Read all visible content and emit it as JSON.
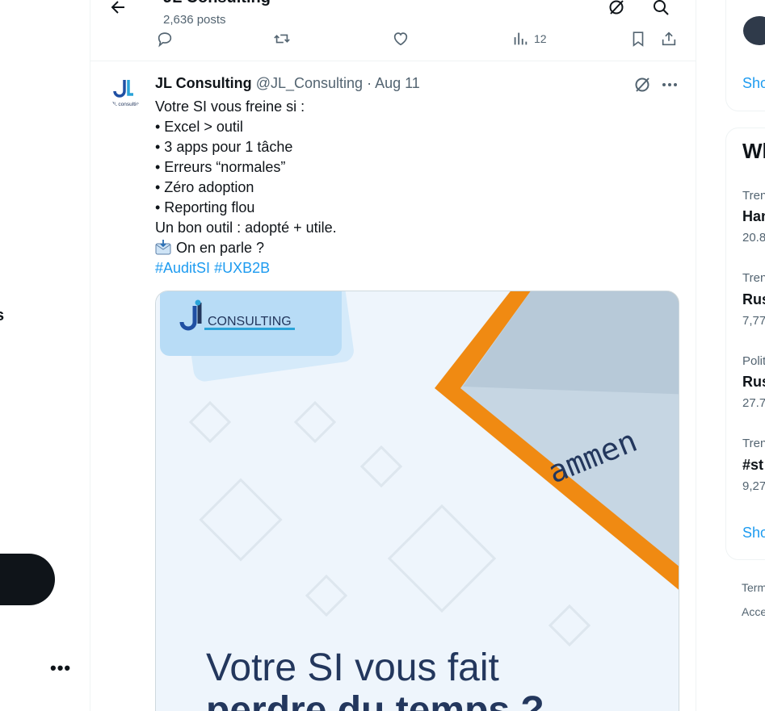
{
  "header": {
    "profile_name": "JL Consulting",
    "posts_count": "2,636 posts"
  },
  "prev_tweet_actions": {
    "views": "12"
  },
  "tweet": {
    "display_name": "JL Consulting",
    "handle": "@JL_Consulting",
    "date": "Aug 11",
    "lines": [
      "Votre SI vous freine si :",
      "• Excel > outil",
      "• 3 apps pour 1 tâche",
      "• Erreurs “normales”",
      "• Zéro adoption",
      "• Reporting flou",
      "Un bon outil : adopté + utile."
    ],
    "cta": "On en parle ?",
    "hashtags": [
      "#AuditSI",
      "#UXB2B"
    ],
    "image": {
      "logo_letters": "JL",
      "logo_word": "CONSULTING",
      "paper_word": "ammen",
      "headline_1": "Votre SI vous fait",
      "headline_2": "perdre du temps ?"
    }
  },
  "left_nav": {
    "partial_label": "s"
  },
  "right_sidebar": {
    "search_glyph": "S",
    "show_more_1": "Sho",
    "section_title": "Wh",
    "trends": [
      {
        "category": "Tren",
        "name": "Han",
        "count": "20.8"
      },
      {
        "category": "Tren",
        "name": "Rus",
        "count": "7,77"
      },
      {
        "category": "Polit",
        "name": "Rus",
        "count": "27.7"
      },
      {
        "category": "Tren",
        "name": "#st",
        "count": "9,27"
      }
    ],
    "show_more_2": "Sho",
    "footer": [
      "Term",
      "Acce"
    ]
  },
  "colors": {
    "link": "#1d9bf0",
    "text": "#0f1419",
    "muted": "#536471",
    "orange": "#f08a12",
    "navy": "#23375d"
  }
}
